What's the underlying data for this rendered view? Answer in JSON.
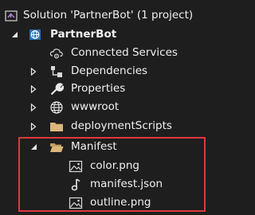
{
  "solution_explorer": {
    "solution": {
      "label": "Solution 'PartnerBot' (1 project)",
      "icon": "visual-studio-solution-icon"
    },
    "project": {
      "label": "PartnerBot",
      "icon": "web-project-globe-icon",
      "expanded": true
    },
    "items": [
      {
        "label": "Connected Services",
        "icon": "cloud-gear-icon",
        "expandable": false
      },
      {
        "label": "Dependencies",
        "icon": "dependencies-icon",
        "expandable": true
      },
      {
        "label": "Properties",
        "icon": "wrench-icon",
        "expandable": true
      },
      {
        "label": "wwwroot",
        "icon": "globe-icon",
        "expandable": true
      },
      {
        "label": "deploymentScripts",
        "icon": "folder-icon",
        "expandable": true
      }
    ],
    "manifest_folder": {
      "label": "Manifest",
      "icon": "folder-open-icon",
      "expanded": true,
      "files": [
        {
          "label": "color.png",
          "icon": "image-file-icon"
        },
        {
          "label": "manifest.json",
          "icon": "json-file-icon"
        },
        {
          "label": "outline.png",
          "icon": "image-file-icon"
        }
      ]
    },
    "highlight_color": "#e0383e",
    "background_color": "#1e1e1e",
    "text_color": "#f1f1f1"
  }
}
